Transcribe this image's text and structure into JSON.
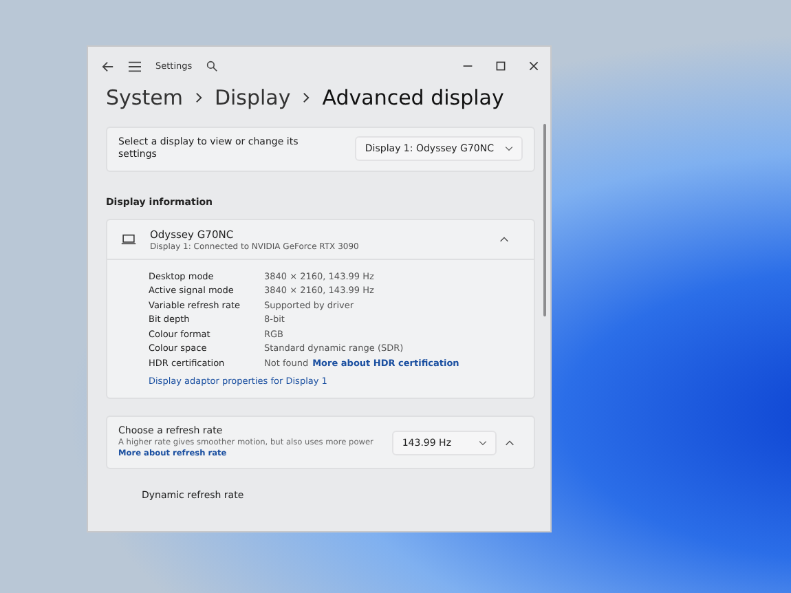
{
  "window": {
    "title": "Settings"
  },
  "breadcrumb": [
    {
      "label": "System",
      "current": false
    },
    {
      "label": "Display",
      "current": false
    },
    {
      "label": "Advanced display",
      "current": true
    }
  ],
  "display_select": {
    "label": "Select a display to view or change its settings",
    "value": "Display 1: Odyssey G70NC"
  },
  "section_title": "Display information",
  "monitor": {
    "name": "Odyssey G70NC",
    "subtitle": "Display 1: Connected to NVIDIA GeForce RTX 3090",
    "expanded": true,
    "properties": [
      {
        "label": "Desktop mode",
        "value": "3840 × 2160, 143.99 Hz"
      },
      {
        "label": "Active signal mode",
        "value": "3840 × 2160, 143.99 Hz"
      },
      {
        "label": "Variable refresh rate",
        "value": "Supported by driver"
      },
      {
        "label": "Bit depth",
        "value": "8-bit"
      },
      {
        "label": "Colour format",
        "value": "RGB"
      },
      {
        "label": "Colour space",
        "value": "Standard dynamic range (SDR)"
      },
      {
        "label": "HDR certification",
        "value": "Not found",
        "link": "More about HDR certification"
      }
    ],
    "adapter_link": "Display adaptor properties for Display 1"
  },
  "refresh_rate": {
    "title": "Choose a refresh rate",
    "description": "A higher rate gives smoother motion, but also uses more power",
    "link": "More about refresh rate",
    "value": "143.99 Hz",
    "expanded": true
  },
  "dynamic_refresh": {
    "title": "Dynamic refresh rate"
  }
}
